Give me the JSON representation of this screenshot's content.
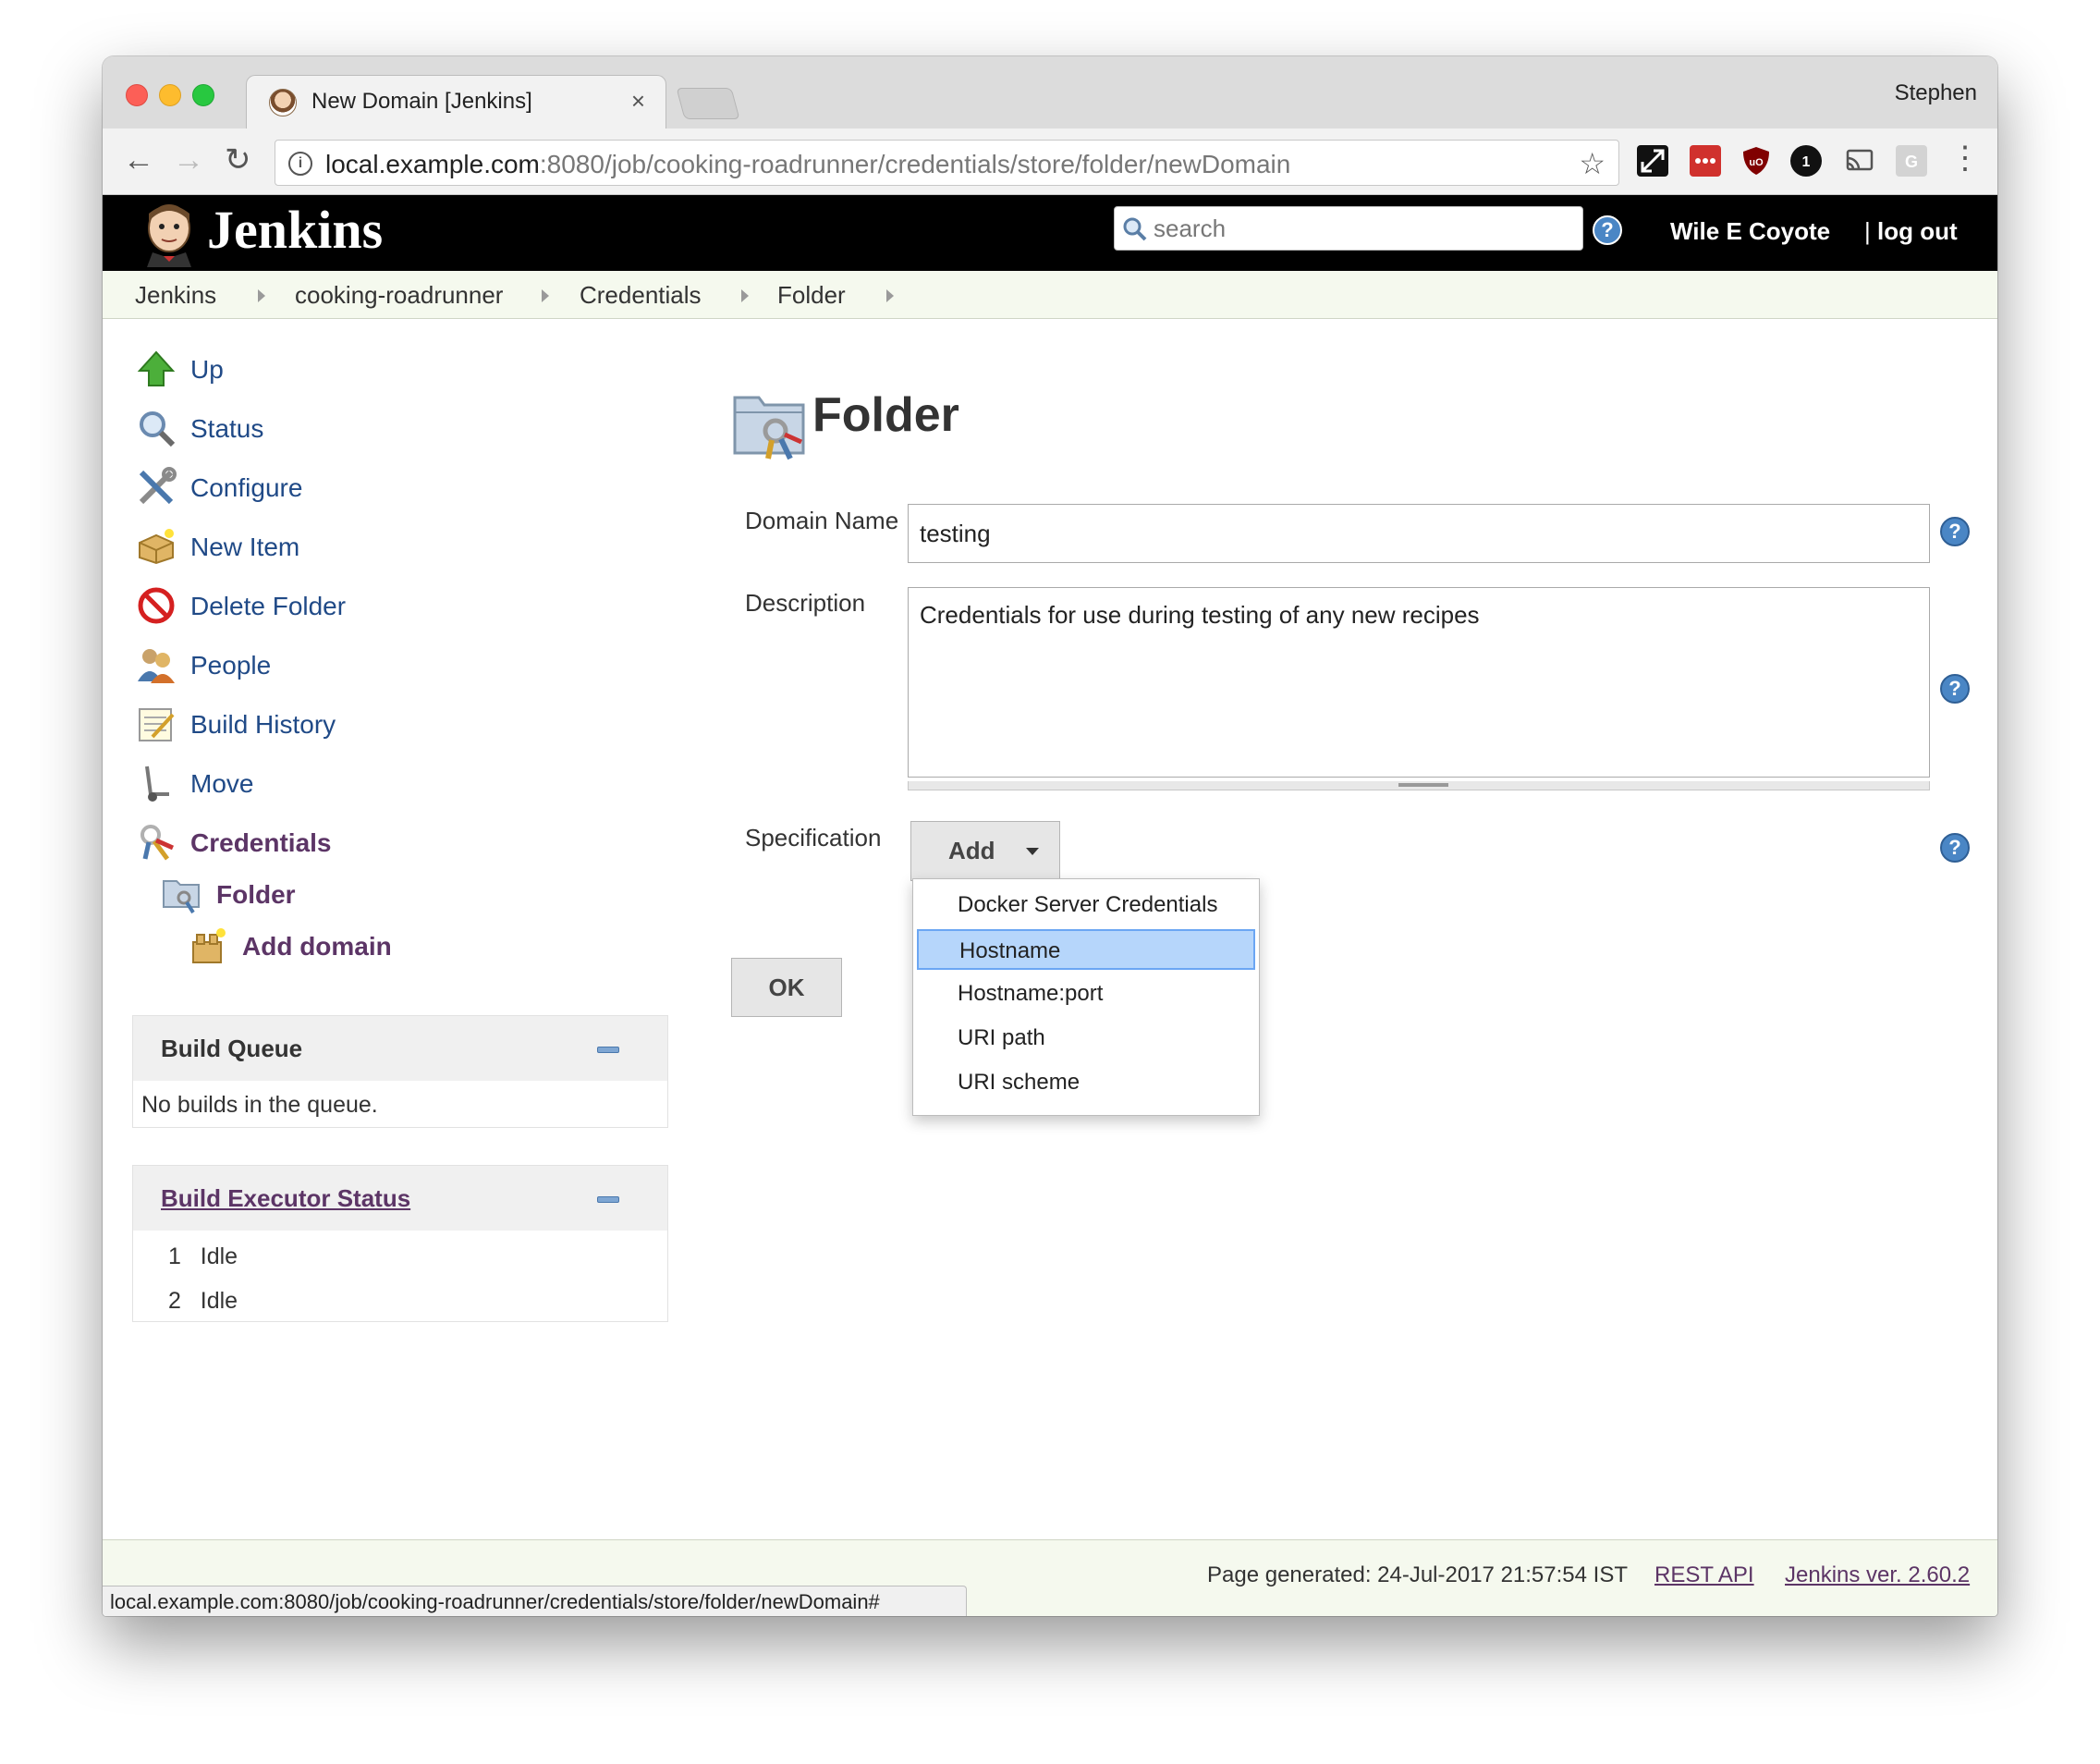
{
  "browser": {
    "tab_title": "New Domain [Jenkins]",
    "tab_close": "×",
    "profile": "Stephen",
    "url_host": "local.example.com",
    "url_path": ":8080/job/cooking-roadrunner/credentials/store/folder/newDomain",
    "back": "←",
    "forward": "→",
    "reload": "↻",
    "bookmark": "☆",
    "menu": "⋮",
    "status_url": "local.example.com:8080/job/cooking-roadrunner/credentials/store/folder/newDomain#"
  },
  "header": {
    "logo": "Jenkins",
    "search_placeholder": "search",
    "help": "?",
    "user": "Wile E Coyote",
    "separator": "|",
    "logout": "log out"
  },
  "breadcrumb": [
    "Jenkins",
    "cooking-roadrunner",
    "Credentials",
    "Folder"
  ],
  "sidebar": {
    "items": [
      {
        "label": "Up",
        "icon": "up-arrow-icon"
      },
      {
        "label": "Status",
        "icon": "magnifier-icon"
      },
      {
        "label": "Configure",
        "icon": "tools-icon"
      },
      {
        "label": "New Item",
        "icon": "new-package-icon"
      },
      {
        "label": "Delete Folder",
        "icon": "no-entry-icon"
      },
      {
        "label": "People",
        "icon": "people-icon"
      },
      {
        "label": "Build History",
        "icon": "notepad-icon"
      },
      {
        "label": "Move",
        "icon": "hand-truck-icon"
      },
      {
        "label": "Credentials",
        "icon": "keys-icon"
      },
      {
        "label": "Folder",
        "icon": "folder-keys-icon"
      },
      {
        "label": "Add domain",
        "icon": "add-domain-icon"
      }
    ]
  },
  "build_queue": {
    "title": "Build Queue",
    "empty_text": "No builds in the queue."
  },
  "executors": {
    "title": "Build Executor Status",
    "rows": [
      {
        "num": "1",
        "status": "Idle"
      },
      {
        "num": "2",
        "status": "Idle"
      }
    ]
  },
  "form": {
    "title": "Folder",
    "domain_label": "Domain Name",
    "domain_value": "testing",
    "description_label": "Description",
    "description_value": "Credentials for use during testing of any new recipes",
    "specification_label": "Specification",
    "add_label": "Add",
    "ok_label": "OK",
    "help": "?"
  },
  "dropdown": {
    "options": [
      "Docker Server Credentials",
      "Hostname",
      "Hostname:port",
      "URI path",
      "URI scheme"
    ],
    "selected": "Hostname"
  },
  "footer": {
    "generated": "Page generated: 24-Jul-2017 21:57:54 IST",
    "rest_api": "REST API",
    "version": "Jenkins ver. 2.60.2"
  },
  "colors": {
    "link": "#204a87",
    "visited": "#5c3566",
    "header_bg": "#000000",
    "selection": "#b6d6fb"
  }
}
